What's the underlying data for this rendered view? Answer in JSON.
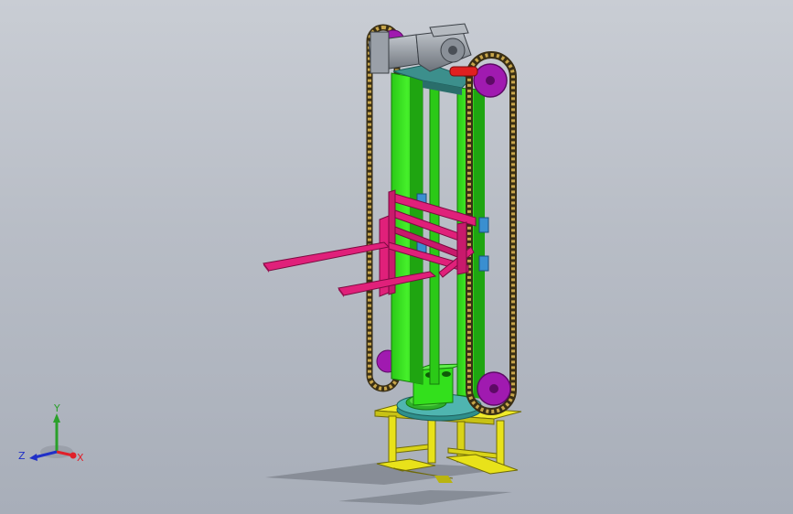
{
  "viewport": {
    "background_top": "#c9cdd4",
    "background_bottom": "#a8aeb9"
  },
  "model": {
    "colors": {
      "frame": "#33e01c",
      "frame_dark": "#1fa511",
      "fork": "#e0207a",
      "fork_dark": "#b0155e",
      "sprocket": "#a01ab0",
      "chain": "#6b5a2c",
      "stand": "#e8e21a",
      "stand_dark": "#b9b40f",
      "motor": "#9aa0a8",
      "shaft": "#e02020",
      "plate": "#3c8f8c"
    }
  },
  "triad": {
    "x_label": "X",
    "y_label": "Y",
    "z_label": "Z",
    "x_color": "#e0202a",
    "y_color": "#2aa02a",
    "z_color": "#2030c8"
  }
}
